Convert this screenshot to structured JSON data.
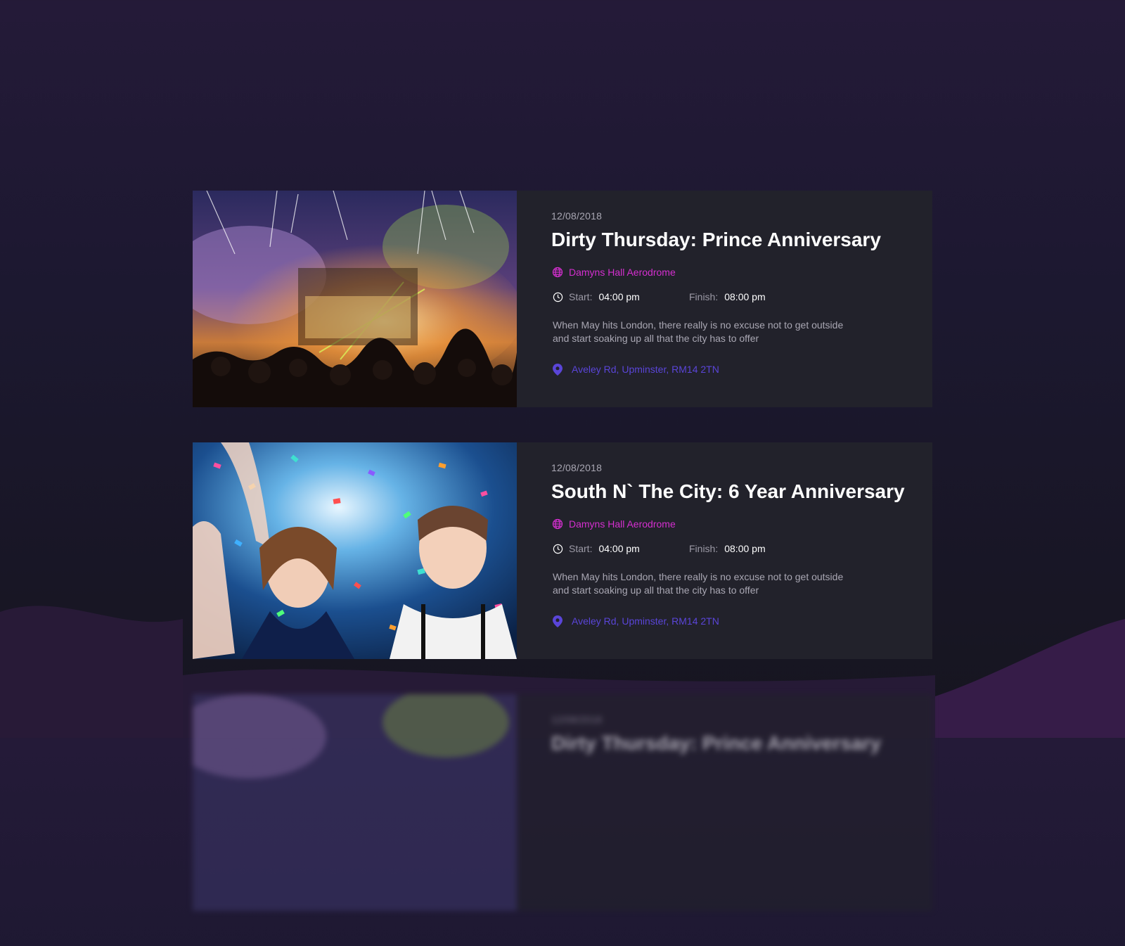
{
  "events": [
    {
      "date": "12/08/2018",
      "title": "Dirty Thursday: Prince Anniversary",
      "venue": "Damyns Hall Aerodrome",
      "start_label": "Start:",
      "start_time": "04:00 pm",
      "finish_label": "Finish:",
      "finish_time": "08:00 pm",
      "description": "When May hits London, there really is no excuse not to get outside and start soaking up all that the city has to offer",
      "address": "Aveley Rd, Upminster, RM14 2TN",
      "image_icon": "concert-stage-fireworks-photo"
    },
    {
      "date": "12/08/2018",
      "title": "South N` The City: 6 Year Anniversary",
      "venue": "Damyns Hall Aerodrome",
      "start_label": "Start:",
      "start_time": "04:00 pm",
      "finish_label": "Finish:",
      "finish_time": "08:00 pm",
      "description": "When May hits London, there really is no excuse not to get outside and start soaking up all that the city has to offer",
      "address": "Aveley Rd, Upminster, RM14 2TN",
      "image_icon": "confetti-party-photo"
    },
    {
      "date": "12/08/2018",
      "title": "Dirty Thursday: Prince Anniversary",
      "image_icon": "concert-stage-fireworks-photo"
    }
  ],
  "colors": {
    "background_top": "#241a38",
    "card_background": "#22222b",
    "venue_accent": "#d52fd0",
    "address_accent": "#5a45d8",
    "title": "#ffffff",
    "muted_text": "#a9a7b3"
  },
  "icons": [
    "globe-icon",
    "clock-icon",
    "map-pin-icon"
  ]
}
